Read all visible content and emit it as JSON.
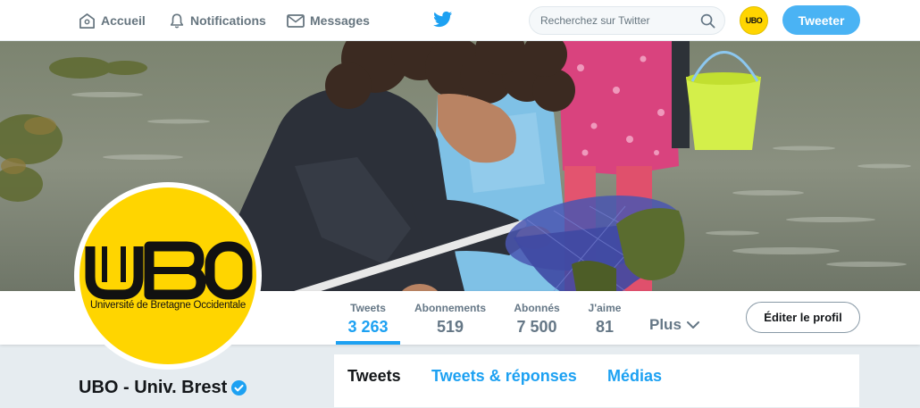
{
  "nav": {
    "home_label": "Accueil",
    "notifications_label": "Notifications",
    "messages_label": "Messages"
  },
  "search": {
    "placeholder": "Recherchez sur Twitter"
  },
  "tweet_button_label": "Tweeter",
  "small_avatar_text": "UBO",
  "profile": {
    "logo_letters": "UBO",
    "logo_subtitle": "Université de Bretagne Occidentale",
    "name": "UBO - Univ. Brest",
    "verified": true
  },
  "stats": [
    {
      "label": "Tweets",
      "value": "3 263",
      "active": true
    },
    {
      "label": "Abonnements",
      "value": "519",
      "active": false
    },
    {
      "label": "Abonnés",
      "value": "7 500",
      "active": false
    },
    {
      "label": "J'aime",
      "value": "81",
      "active": false
    }
  ],
  "more_label": "Plus",
  "edit_profile_label": "Éditer le profil",
  "timeline_tabs": [
    {
      "label": "Tweets",
      "active": true
    },
    {
      "label": "Tweets & réponses",
      "active": false
    },
    {
      "label": "Médias",
      "active": false
    }
  ],
  "colors": {
    "accent": "#1da1f2",
    "tweet_button": "#4ab3f4",
    "brand_yellow": "#ffd500"
  },
  "icons": [
    "home-icon",
    "bell-icon",
    "envelope-icon",
    "twitter-bird-icon",
    "search-icon",
    "chevron-down-icon",
    "verified-icon"
  ]
}
